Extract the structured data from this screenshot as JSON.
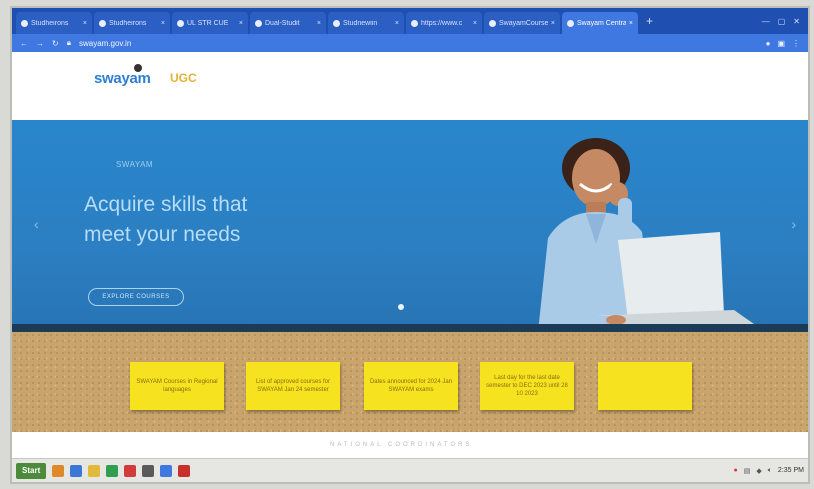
{
  "tabs": [
    {
      "label": "Studheirons",
      "active": false
    },
    {
      "label": "Studheirons",
      "active": false
    },
    {
      "label": "UL STR CUE",
      "active": false
    },
    {
      "label": "Dual-Studit",
      "active": false
    },
    {
      "label": "Studnewiin",
      "active": false
    },
    {
      "label": "https://www.c",
      "active": false
    },
    {
      "label": "SwayamCourse",
      "active": false
    },
    {
      "label": "Swayam Central",
      "active": true
    }
  ],
  "address_bar": {
    "url": "swayam.gov.in"
  },
  "site": {
    "logo": "swayam",
    "partner_logo": "UGC"
  },
  "hero": {
    "eyebrow": "SWAYAM",
    "title_line1": "Acquire skills that",
    "title_line2": "meet your needs",
    "button_label": "EXPLORE COURSES"
  },
  "notes": [
    "SWAYAM Courses in Regional languages",
    "List of approved courses for SWAYAM Jan 24 semester",
    "Dates announced for 2024 Jan SWAYAM exams",
    "Last day for the last date semester to DEC 2023 until 28 10 2023",
    ""
  ],
  "footer": {
    "text": "NATIONAL COORDINATORS"
  },
  "taskbar": {
    "start_label": "Start",
    "clock": "2:35 PM"
  },
  "colors": {
    "hero_blue": "#2a86cc",
    "note_yellow": "#f6e21f",
    "tab_blue": "#1f4fb0",
    "logo_blue": "#2f7fd1"
  }
}
